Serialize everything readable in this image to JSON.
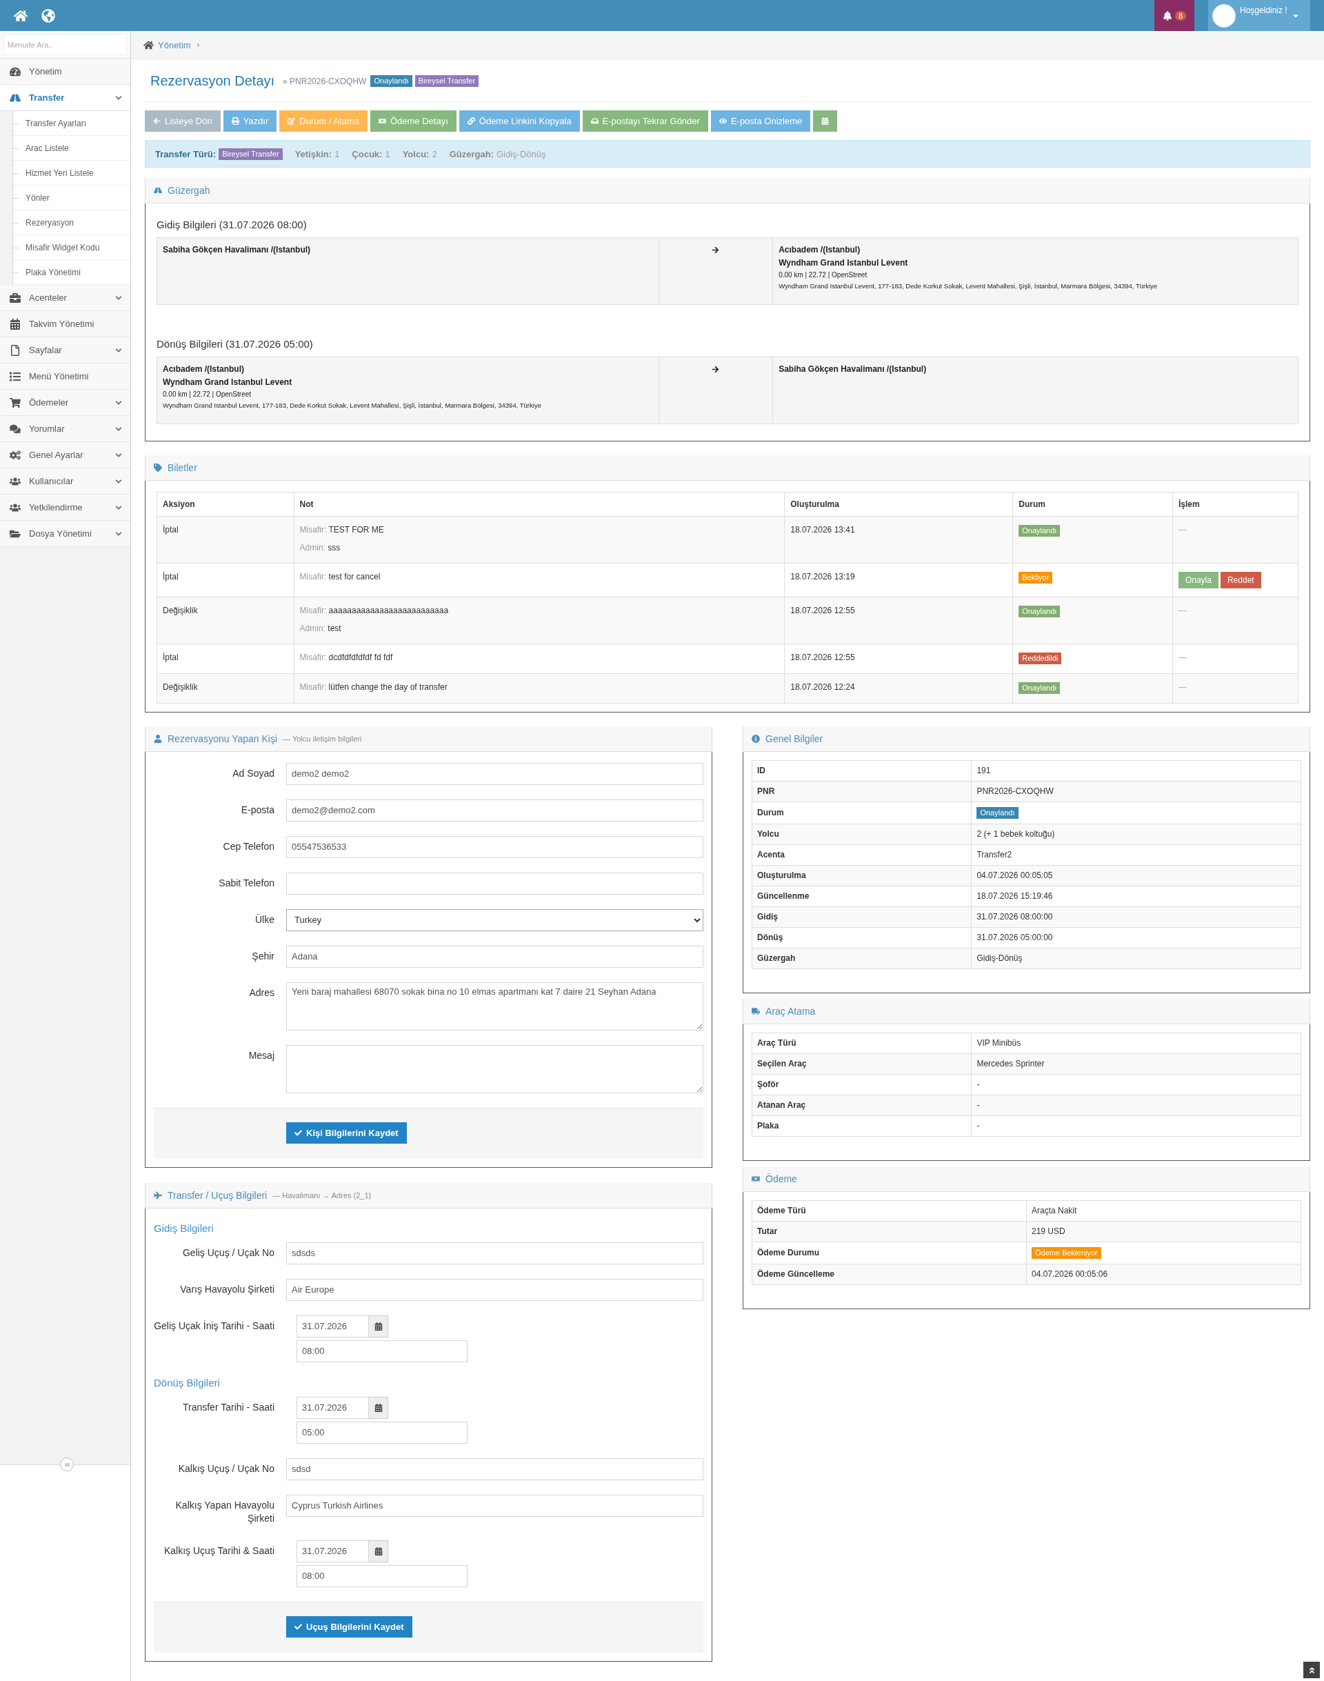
{
  "topbar": {
    "notifications": "8",
    "greeting": "Hoşgeldiniz !"
  },
  "sidebar": {
    "search_placeholder": "Menude Ara..",
    "items": [
      {
        "label": "Yönetim",
        "selected": false
      },
      {
        "label": "Transfer",
        "expandable": true,
        "selected": true,
        "expanded": true,
        "children": [
          {
            "label": "Transfer Ayarları",
            "selected": false
          },
          {
            "label": "Arac Listele",
            "selected": false
          },
          {
            "label": "Hizmet Yeri Listele",
            "selected": false
          },
          {
            "label": "Yönler",
            "selected": false
          },
          {
            "label": "Rezeryasyon",
            "selected": false
          },
          {
            "label": "Misafir Widget Kodu",
            "selected": false
          },
          {
            "label": "Plaka Yönetimi",
            "selected": false
          }
        ]
      },
      {
        "label": "Acenteler",
        "expandable": true,
        "selected": false
      },
      {
        "label": "Takvim Yönetimi",
        "selected": false
      },
      {
        "label": "Sayfalar",
        "expandable": true,
        "selected": false
      },
      {
        "label": "Menü Yönetimi",
        "selected": false
      },
      {
        "label": "Ödemeler",
        "expandable": true,
        "selected": false
      },
      {
        "label": "Yorumlar",
        "expandable": true,
        "selected": false
      },
      {
        "label": "Genel Ayarlar",
        "expandable": true,
        "selected": false
      },
      {
        "label": "Kullanıcılar",
        "expandable": true,
        "selected": false
      },
      {
        "label": "Yetkilendirme",
        "expandable": true,
        "selected": false
      },
      {
        "label": "Dosya Yönetimi",
        "expandable": true,
        "selected": false
      }
    ]
  },
  "breadcrumb": [
    "Yönetim"
  ],
  "header": {
    "title": "Rezervasyon Detayı",
    "pnr": "» PNR2026-CXOQHW",
    "badges": [
      {
        "label": "Onaylandı",
        "color": "#3a87ad"
      },
      {
        "label": "Bireysel Transfer",
        "color": "#8f7ab9"
      }
    ]
  },
  "toolbar": [
    {
      "label": "Listeye Dön",
      "color": "#abbac3"
    },
    {
      "label": "Yazdır",
      "color": "#6fb3e0"
    },
    {
      "label": "Durum / Atama",
      "color": "#ffb752"
    },
    {
      "label": "Ödeme Detayı",
      "color": "#87b87f"
    },
    {
      "label": "Ödeme Linkini Kopyala",
      "color": "#6fb3e0"
    },
    {
      "label": "E-postayı Tekrar Gönder",
      "color": "#87b87f"
    },
    {
      "label": "E-posta Onizleme",
      "color": "#6fb3e0"
    },
    {
      "color": "#87b87f"
    }
  ],
  "summary": [
    {
      "kind": "badge",
      "label": "Transfer Türü:",
      "value": "Bireysel Transfer",
      "color": "#8f7ab9"
    },
    {
      "kind": "text",
      "label": "Yetişkin:",
      "value": "1"
    },
    {
      "kind": "text",
      "label": "Çocuk:",
      "value": "1"
    },
    {
      "kind": "text",
      "label": "Yolcu:",
      "value": "2"
    },
    {
      "kind": "text",
      "label": "Güzergah:",
      "value": "Gidiş-Dönüş"
    }
  ],
  "route": {
    "title": "Güzergah",
    "legs": [
      {
        "heading": "Gidiş Bilgileri (31.07.2026 08:00)",
        "from": {
          "name": "Sabiha Gökçen Havalimanı /(Istanbul)"
        },
        "to": {
          "name": "Acıbadem /(Istanbul)",
          "hotel": "Wyndham Grand Istanbul Levent",
          "meta": "0.00 km | 22.72 | OpenStreet",
          "address": "Wyndham Grand Istanbul Levent, 177-183, Dede Korkut Sokak, Levent Mahallesi, Şişli, İstanbul, Marmara Bölgesi, 34394, Türkiye"
        }
      },
      {
        "heading": "Dönüş Bilgileri (31.07.2026 05:00)",
        "from": {
          "name": "Acıbadem /(Istanbul)",
          "hotel": "Wyndham Grand Istanbul Levent",
          "meta": "0.00 km | 22.72 | OpenStreet",
          "address": "Wyndham Grand Istanbul Levent, 177-183, Dede Korkut Sokak, Levent Mahallesi, Şişli, İstanbul, Marmara Bölgesi, 34394, Türkiye"
        },
        "to": {
          "name": "Sabiha Gökçen Havalimanı /(Istanbul)"
        }
      }
    ]
  },
  "tickets": {
    "title": "Biletler",
    "columns": [
      "Aksiyon",
      "Not",
      "Oluşturulma",
      "Durum",
      "İşlem"
    ],
    "rows": [
      {
        "action": "İptal",
        "notes": [
          {
            "label": "Misafir:",
            "text": "TEST FOR ME"
          },
          {
            "label": "Admin:",
            "text": "sss"
          }
        ],
        "created": "18.07.2026 13:41",
        "status": {
          "label": "Onaylandı",
          "color": "#82af6f"
        },
        "operation": "—"
      },
      {
        "action": "İptal",
        "notes": [
          {
            "label": "Misafir:",
            "text": "test for cancel"
          }
        ],
        "created": "18.07.2026 13:19",
        "status": {
          "label": "Bekliyor",
          "color": "#f89406"
        },
        "buttons": [
          {
            "label": "Onayla",
            "color": "#87b87f"
          },
          {
            "label": "Reddet",
            "color": "#d15b47"
          }
        ]
      },
      {
        "action": "Değişiklik",
        "notes": [
          {
            "label": "Misafir:",
            "text": "aaaaaaaaaaaaaaaaaaaaaaaaaa"
          },
          {
            "label": "Admin:",
            "text": "test"
          }
        ],
        "created": "18.07.2026 12:55",
        "status": {
          "label": "Onaylandı",
          "color": "#82af6f"
        },
        "operation": "—"
      },
      {
        "action": "İptal",
        "notes": [
          {
            "label": "Misafir:",
            "text": "dcdfdfdfdfdf fd fdf"
          }
        ],
        "created": "18.07.2026 12:55",
        "status": {
          "label": "Reddedildi",
          "color": "#d15b47"
        },
        "operation": "—"
      },
      {
        "action": "Değişiklik",
        "notes": [
          {
            "label": "Misafir:",
            "text": "lütfen change the day of transfer"
          }
        ],
        "created": "18.07.2026 12:24",
        "status": {
          "label": "Onaylandı",
          "color": "#82af6f"
        },
        "operation": "—"
      }
    ]
  },
  "person": {
    "title": "Rezervasyonu Yapan Kişi",
    "subtitle": "— Yolcu iletişim bilgileri",
    "fields": [
      {
        "label": "Ad Soyad",
        "kind": "text",
        "value": "demo2 demo2"
      },
      {
        "label": "E-posta",
        "kind": "text",
        "value": "demo2@demo2.com"
      },
      {
        "label": "Cep Telefon",
        "kind": "text",
        "value": "05547536533"
      },
      {
        "label": "Sabit Telefon",
        "kind": "text"
      },
      {
        "label": "Ülke",
        "kind": "select",
        "value": "Turkey"
      },
      {
        "label": "Şehir",
        "kind": "text",
        "value": "Adana"
      },
      {
        "label": "Adres",
        "kind": "textarea",
        "value": "Yeni baraj mahallesi 68070 sokak bina no 10 elmas apartmanı kat 7 daire 21 Seyhan Adana"
      },
      {
        "label": "Mesaj",
        "kind": "textarea"
      }
    ],
    "button": "Kişi Bilgilerini Kaydet"
  },
  "flight": {
    "title": "Transfer / Uçuş Bilgileri",
    "subtitle": "— Havalimanı → Adres (2_1)",
    "sections": [
      {
        "heading": "Gidiş Bilgileri",
        "fields": [
          {
            "label": "Geliş Uçuş / Uçak No",
            "kind": "text",
            "value": "sdsds"
          },
          {
            "label": "Varış Havayolu Şirketi",
            "kind": "text",
            "value": "Air Europe"
          },
          {
            "label": "Geliş Uçak İniş Tarihi - Saati",
            "kind": "datetime",
            "date": "31.07.2026",
            "time": "08:00"
          }
        ]
      },
      {
        "heading": "Dönüş Bilgileri",
        "fields": [
          {
            "label": "Transfer Tarihi - Saati",
            "kind": "datetime",
            "date": "31.07.2026",
            "time": "05:00"
          },
          {
            "label": "Kalkış Uçuş / Uçak No",
            "kind": "text",
            "value": "sdsd"
          },
          {
            "label": "Kalkış Yapan Havayolu Şirketi",
            "kind": "text",
            "value": "Cyprus Turkish Airlines"
          },
          {
            "label": "Kalkış Uçuş Tarihi & Saati",
            "kind": "datetime",
            "date": "31.07.2026",
            "time": "08:00"
          }
        ]
      }
    ],
    "button": "Uçuş Bilgilerini Kaydet"
  },
  "info_panels": [
    {
      "title": "Genel Bilgiler",
      "rows": [
        {
          "label": "ID",
          "value": "191"
        },
        {
          "label": "PNR",
          "value": "PNR2026-CXOQHW"
        },
        {
          "label": "Durum",
          "badge": {
            "label": "Onaylandı",
            "color": "#3a87ad"
          }
        },
        {
          "label": "Yolcu",
          "value": "2 (+ 1 bebek koltuğu)"
        },
        {
          "label": "Acenta",
          "value": "Transfer2"
        },
        {
          "label": "Oluşturulma",
          "value": "04.07.2026 00:05:05"
        },
        {
          "label": "Güncellenme",
          "value": "18.07.2026 15:19:46"
        },
        {
          "label": "Gidiş",
          "value": "31.07.2026 08:00:00"
        },
        {
          "label": "Dönüş",
          "value": "31.07.2026 05:00:00"
        },
        {
          "label": "Güzergah",
          "value": "Gidiş-Dönüş"
        }
      ]
    },
    {
      "title": "Araç Atama",
      "rows": [
        {
          "label": "Araç Türü",
          "value": "VIP Minibüs"
        },
        {
          "label": "Seçilen Araç",
          "value": "Mercedes Sprinter"
        },
        {
          "label": "Şoför",
          "value": "-"
        },
        {
          "label": "Atanan Araç",
          "value": "-"
        },
        {
          "label": "Plaka",
          "value": "-"
        }
      ]
    },
    {
      "title": "Ödeme",
      "rows": [
        {
          "label": "Ödeme Türü",
          "value": "Araçta Nakit"
        },
        {
          "label": "Tutar",
          "value": "219 USD"
        },
        {
          "label": "Ödeme Durumu",
          "badge": {
            "label": "Ödeme Bekleniyor",
            "color": "#f89406"
          }
        },
        {
          "label": "Ödeme Güncelleme",
          "value": "04.07.2026 00:05:06"
        }
      ]
    }
  ]
}
